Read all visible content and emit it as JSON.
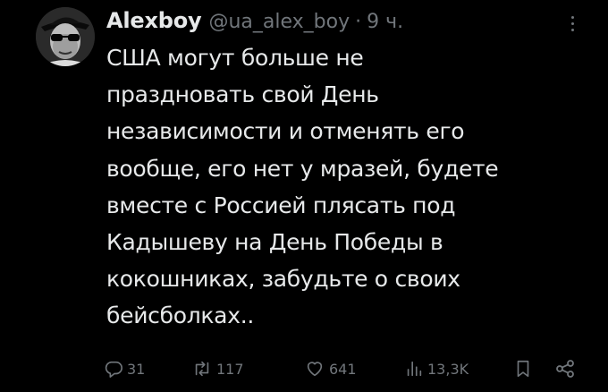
{
  "author": {
    "display_name": "Alexboy",
    "handle": "@ua_alex_boy",
    "separator": "·",
    "time": "9 ч."
  },
  "tweet": {
    "lines": [
      "США могут больше не",
      "праздновать свой День",
      "независимости и отменять его",
      "вообще, его нет у мразей, будете",
      "вместе с Россией плясать под",
      "Кадышеву на День Победы в",
      "кокошниках, забудьте о своих",
      "бейсболках.."
    ]
  },
  "actions": {
    "replies": "31",
    "retweets": "117",
    "likes": "641",
    "views": "13,3K"
  },
  "icons": {
    "more": "more-vertical-icon",
    "reply": "reply-icon",
    "retweet": "retweet-icon",
    "like": "heart-icon",
    "views": "views-icon",
    "bookmark": "bookmark-icon",
    "share": "share-icon"
  },
  "colors": {
    "background": "#000000",
    "text": "#e7e9ea",
    "secondary": "#71767b"
  }
}
